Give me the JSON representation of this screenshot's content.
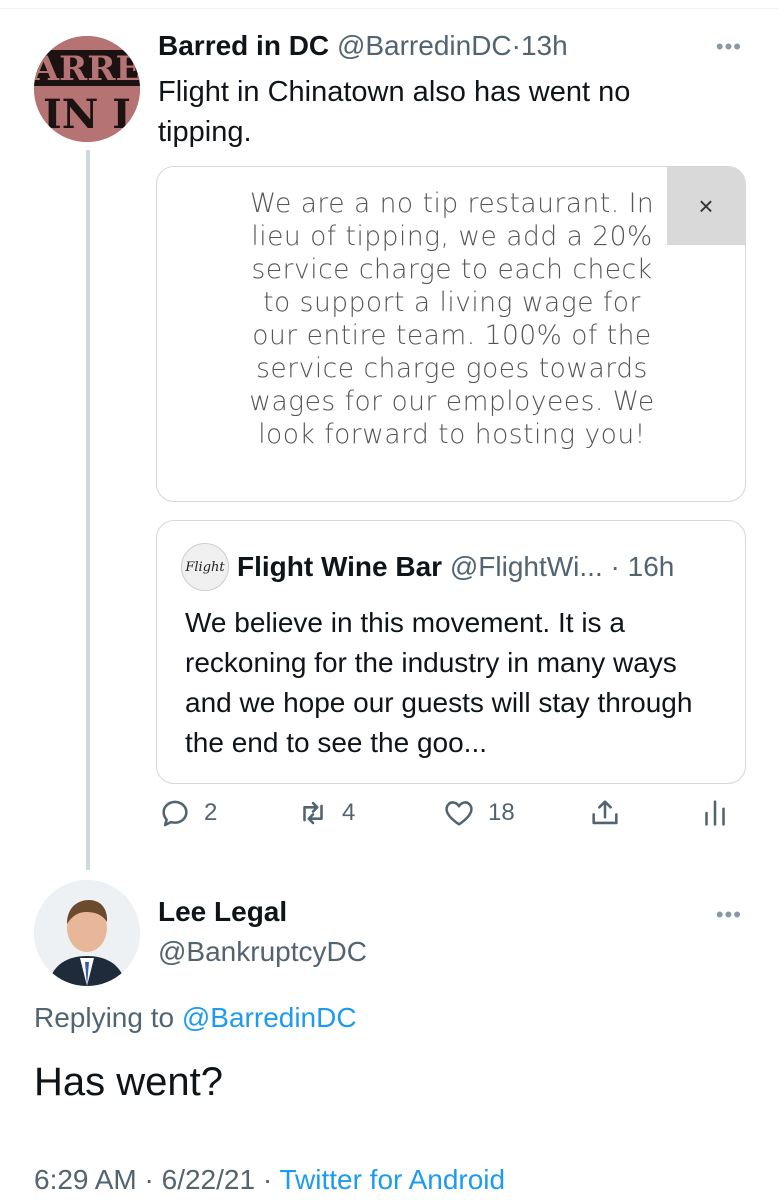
{
  "tweet1": {
    "name": "Barred in DC",
    "handle": "@BarredinDC",
    "time": "13h",
    "separator": "·",
    "avatar_text_top": "ARRE",
    "avatar_text_bottom": "IN I",
    "text": "Flight in Chinatown also has went no tipping.",
    "image_text": "We are a no tip restaurant. In lieu of tipping, we add a 20% service charge to each check to support a living wage for our entire team. 100% of the service charge goes towards wages for our employees. We look forward to hosting you!",
    "close_symbol": "×",
    "quote": {
      "name": "Flight Wine Bar",
      "handle": "@FlightWi...",
      "time": "16h",
      "avatar_text": "Flight",
      "text": "We believe in this movement. It is a reckoning for the industry in many ways and we hope our guests will stay through the end to see the goo..."
    },
    "actions": {
      "replies": "2",
      "retweets": "4",
      "likes": "18"
    },
    "more_symbol": "•••"
  },
  "tweet2": {
    "name": "Lee Legal",
    "handle": "@BankruptcyDC",
    "replying_prefix": "Replying to",
    "replying_to": "@BarredinDC",
    "text": "Has went?",
    "time": "6:29 AM",
    "date": "6/22/21",
    "source": "Twitter for Android",
    "more_symbol": "•••"
  },
  "colors": {
    "link": "#1d9bf0",
    "secondary_text": "#536471",
    "thread_line": "#cfd9de"
  }
}
